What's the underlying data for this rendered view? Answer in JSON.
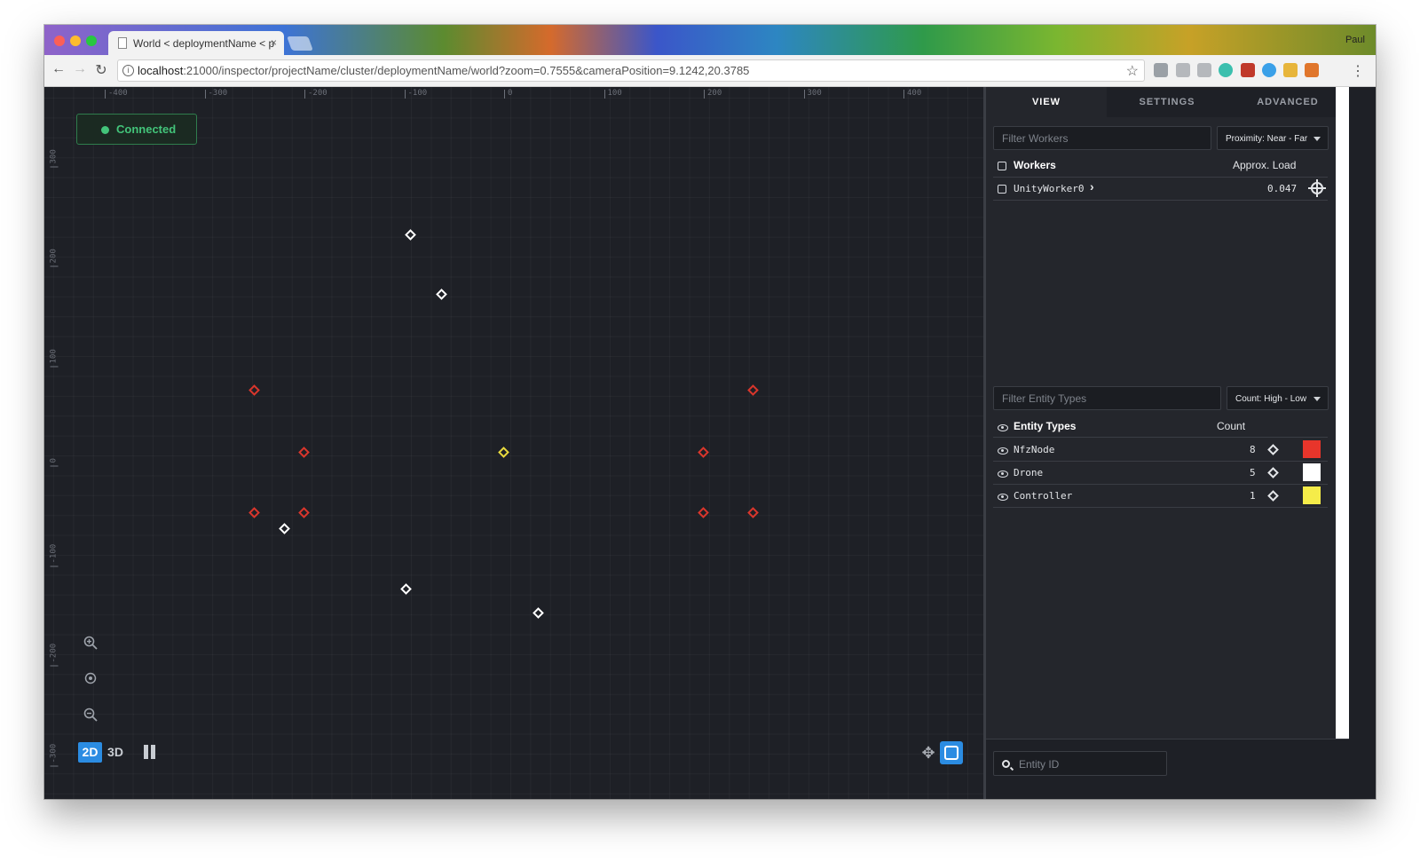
{
  "browser": {
    "tab_title": "World < deploymentName < p",
    "tab_close": "×",
    "user_name": "Paul",
    "url_host": "localhost",
    "url_path": ":21000/inspector/projectName/cluster/deploymentName/world?zoom=0.7555&cameraPosition=9.1242,20.3785",
    "back": "←",
    "forward": "→",
    "reload": "↻",
    "bookmark": "☆",
    "menu": "⋮"
  },
  "viewport": {
    "status": "Connected",
    "x_ticks": [
      "-400",
      "-300",
      "-200",
      "-100",
      "0",
      "100",
      "200",
      "300",
      "400"
    ],
    "y_ticks": [
      "300",
      "200",
      "100",
      "0",
      "-100",
      "-200",
      "-300"
    ],
    "entities": [
      {
        "type": "Drone",
        "x": -93,
        "y": 218
      },
      {
        "type": "Drone",
        "x": -62,
        "y": 158
      },
      {
        "type": "NfzNode",
        "x": -250,
        "y": 62
      },
      {
        "type": "NfzNode",
        "x": 250,
        "y": 62
      },
      {
        "type": "NfzNode",
        "x": -200,
        "y": 0
      },
      {
        "type": "Controller",
        "x": 0,
        "y": 0
      },
      {
        "type": "NfzNode",
        "x": 200,
        "y": 0
      },
      {
        "type": "NfzNode",
        "x": -250,
        "y": -60
      },
      {
        "type": "NfzNode",
        "x": -200,
        "y": -60
      },
      {
        "type": "NfzNode",
        "x": 200,
        "y": -60
      },
      {
        "type": "NfzNode",
        "x": 250,
        "y": -60
      },
      {
        "type": "Drone",
        "x": -220,
        "y": -76
      },
      {
        "type": "Drone",
        "x": -98,
        "y": -137
      },
      {
        "type": "Drone",
        "x": 35,
        "y": -161
      }
    ],
    "zoom_in_icon": "zoom-in-icon",
    "center_icon": "target-icon",
    "zoom_out_icon": "zoom-out-icon",
    "mode_2d": "2D",
    "mode_3d": "3D"
  },
  "panel": {
    "tabs": [
      "VIEW",
      "SETTINGS",
      "ADVANCED"
    ],
    "filter_workers_placeholder": "Filter Workers",
    "proximity_select": "Proximity: Near - Far",
    "workers_header": "Workers",
    "load_header": "Approx. Load",
    "workers": [
      {
        "name": "UnityWorker0",
        "load": "0.047"
      }
    ],
    "filter_entity_placeholder": "Filter Entity Types",
    "count_select": "Count: High - Low",
    "entity_types_header": "Entity Types",
    "count_header": "Count",
    "entity_types": [
      {
        "name": "NfzNode",
        "count": "8",
        "color": "#e8352b"
      },
      {
        "name": "Drone",
        "count": "5",
        "color": "#ffffff"
      },
      {
        "name": "Controller",
        "count": "1",
        "color": "#f5ec49"
      }
    ],
    "entity_id_placeholder": "Entity ID"
  },
  "colors": {
    "NfzNode": "#d9362c",
    "Drone": "#ffffff",
    "Controller": "#e8d93e",
    "accent": "#2b8ce2",
    "connected": "#43c47a"
  }
}
